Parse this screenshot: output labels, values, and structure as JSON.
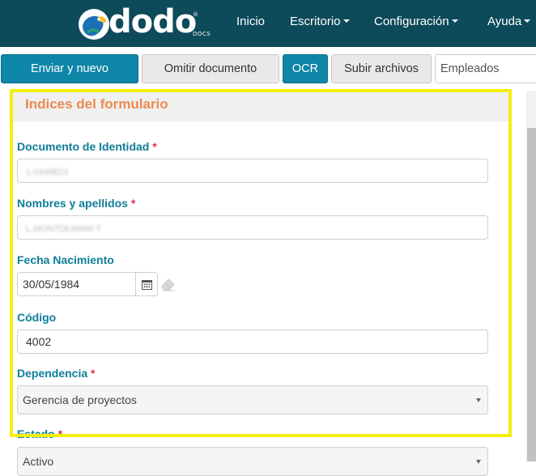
{
  "app": {
    "logo_text": "dodo",
    "logo_registered": "®",
    "logo_subtext": "DOCS"
  },
  "nav": {
    "items": [
      {
        "label": "Inicio"
      },
      {
        "label": "Escritorio"
      },
      {
        "label": "Configuración"
      },
      {
        "label": "Ayuda"
      }
    ]
  },
  "toolbar": {
    "send_new_label": "Enviar y nuevo",
    "skip_label": "Omitir documento",
    "ocr_label": "OCR",
    "upload_label": "Subir archivos",
    "doctype_value": "Empleados"
  },
  "form": {
    "title": "Indices del formulario",
    "required_mark": "*",
    "fields": [
      {
        "label": "Documento de Identidad",
        "required": true,
        "value": "1.0349623"
      },
      {
        "label": "Nombres y apellidos",
        "required": true,
        "value": "L.MONTOLMANI T"
      },
      {
        "label": "Fecha Nacimiento",
        "required": false,
        "value": "30/05/1984"
      },
      {
        "label": "Código",
        "required": false,
        "value": "4002"
      },
      {
        "label": "Dependencia",
        "required": true,
        "value": "Gerencia de proyectos"
      },
      {
        "label": "Estado",
        "required": true,
        "value": "Activo"
      }
    ]
  },
  "colors": {
    "navbar": "#0d4a5a",
    "primary": "#0e86a8",
    "label": "#0e7e9a",
    "title": "#ec8a52",
    "required": "#d9354a",
    "highlight": "#f5ee10"
  },
  "icons": {
    "calendar": "calendar-icon",
    "eraser": "eraser-icon",
    "caret": "caret-down-icon"
  }
}
